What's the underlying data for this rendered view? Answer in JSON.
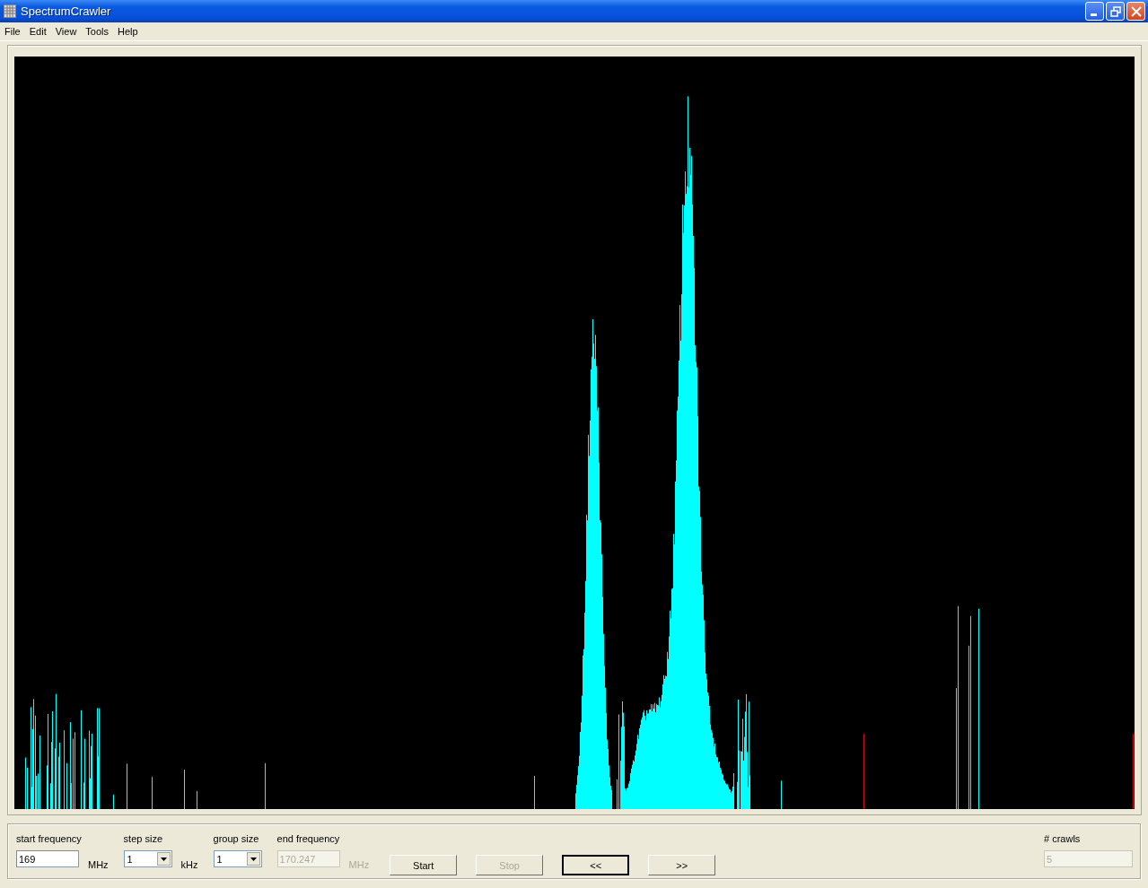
{
  "window": {
    "title": "SpectrumCrawler"
  },
  "menu": [
    "File",
    "Edit",
    "View",
    "Tools",
    "Help"
  ],
  "controls": {
    "start_frequency": {
      "label": "start frequency",
      "value": "169",
      "unit": "MHz",
      "disabled": false
    },
    "step_size": {
      "label": "step size",
      "value": "1",
      "unit": "kHz"
    },
    "group_size": {
      "label": "group size",
      "value": "1"
    },
    "end_frequency": {
      "label": "end frequency",
      "value": "170.247",
      "unit": "MHz",
      "disabled": true
    },
    "buttons": [
      {
        "label": "Start",
        "disabled": false,
        "focused": false
      },
      {
        "label": "Stop",
        "disabled": true,
        "focused": false
      },
      {
        "label": "<<",
        "disabled": false,
        "focused": true
      },
      {
        "label": ">>",
        "disabled": false,
        "focused": false
      }
    ],
    "crawls": {
      "label": "# crawls",
      "value": "5",
      "disabled": true
    }
  }
}
